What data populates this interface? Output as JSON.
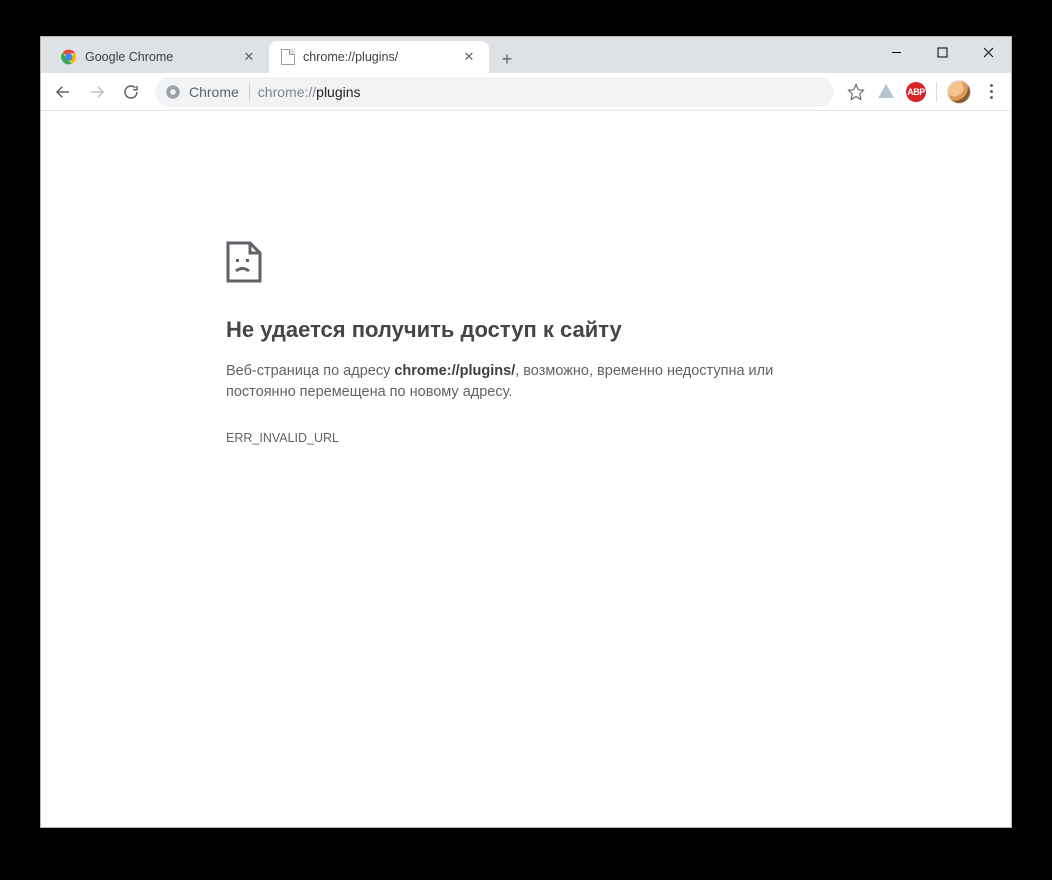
{
  "tabs": [
    {
      "title": "Google Chrome",
      "active": false
    },
    {
      "title": "chrome://plugins/",
      "active": true
    }
  ],
  "toolbar": {
    "chip_label": "Chrome",
    "url_dim": "chrome://",
    "url_bold": "plugins"
  },
  "extensions": {
    "abp_label": "ABP"
  },
  "error": {
    "title": "Не удается получить доступ к сайту",
    "body_pre": "Веб-страница по адресу ",
    "body_url": "chrome://plugins/",
    "body_post": ", возможно, временно недоступна или постоянно перемещена по новому адресу.",
    "code": "ERR_INVALID_URL"
  }
}
